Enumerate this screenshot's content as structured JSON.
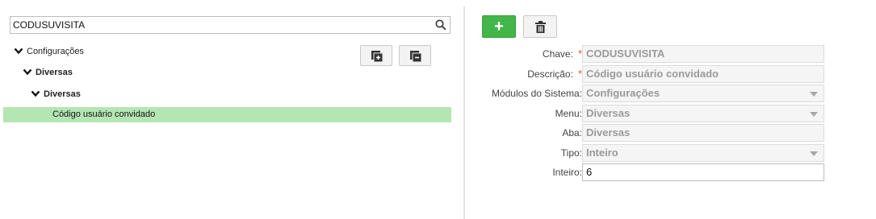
{
  "search": {
    "value": "CODUSUVISITA"
  },
  "tree": {
    "level1": "Configurações",
    "level2": "Diversas",
    "level3": "Diversas",
    "selected": "Código usuário convidado"
  },
  "toolbar": {
    "add_label": "+"
  },
  "form": {
    "chave": {
      "label": "Chave:",
      "required": "*",
      "value": "CODUSUVISITA"
    },
    "descricao": {
      "label": "Descrição:",
      "required": "*",
      "value": "Código usuário convidado"
    },
    "modulos": {
      "label": "Módulos do Sistema:",
      "value": "Configurações"
    },
    "menu": {
      "label": "Menu:",
      "value": "Diversas"
    },
    "aba": {
      "label": "Aba:",
      "value": "Diversas"
    },
    "tipo": {
      "label": "Tipo:",
      "value": "Inteiro"
    },
    "inteiro": {
      "label": "Inteiro:",
      "value": "6"
    }
  },
  "colors": {
    "accent_green": "#43b649",
    "selection": "#b4e6b4",
    "required": "#d9534f"
  }
}
